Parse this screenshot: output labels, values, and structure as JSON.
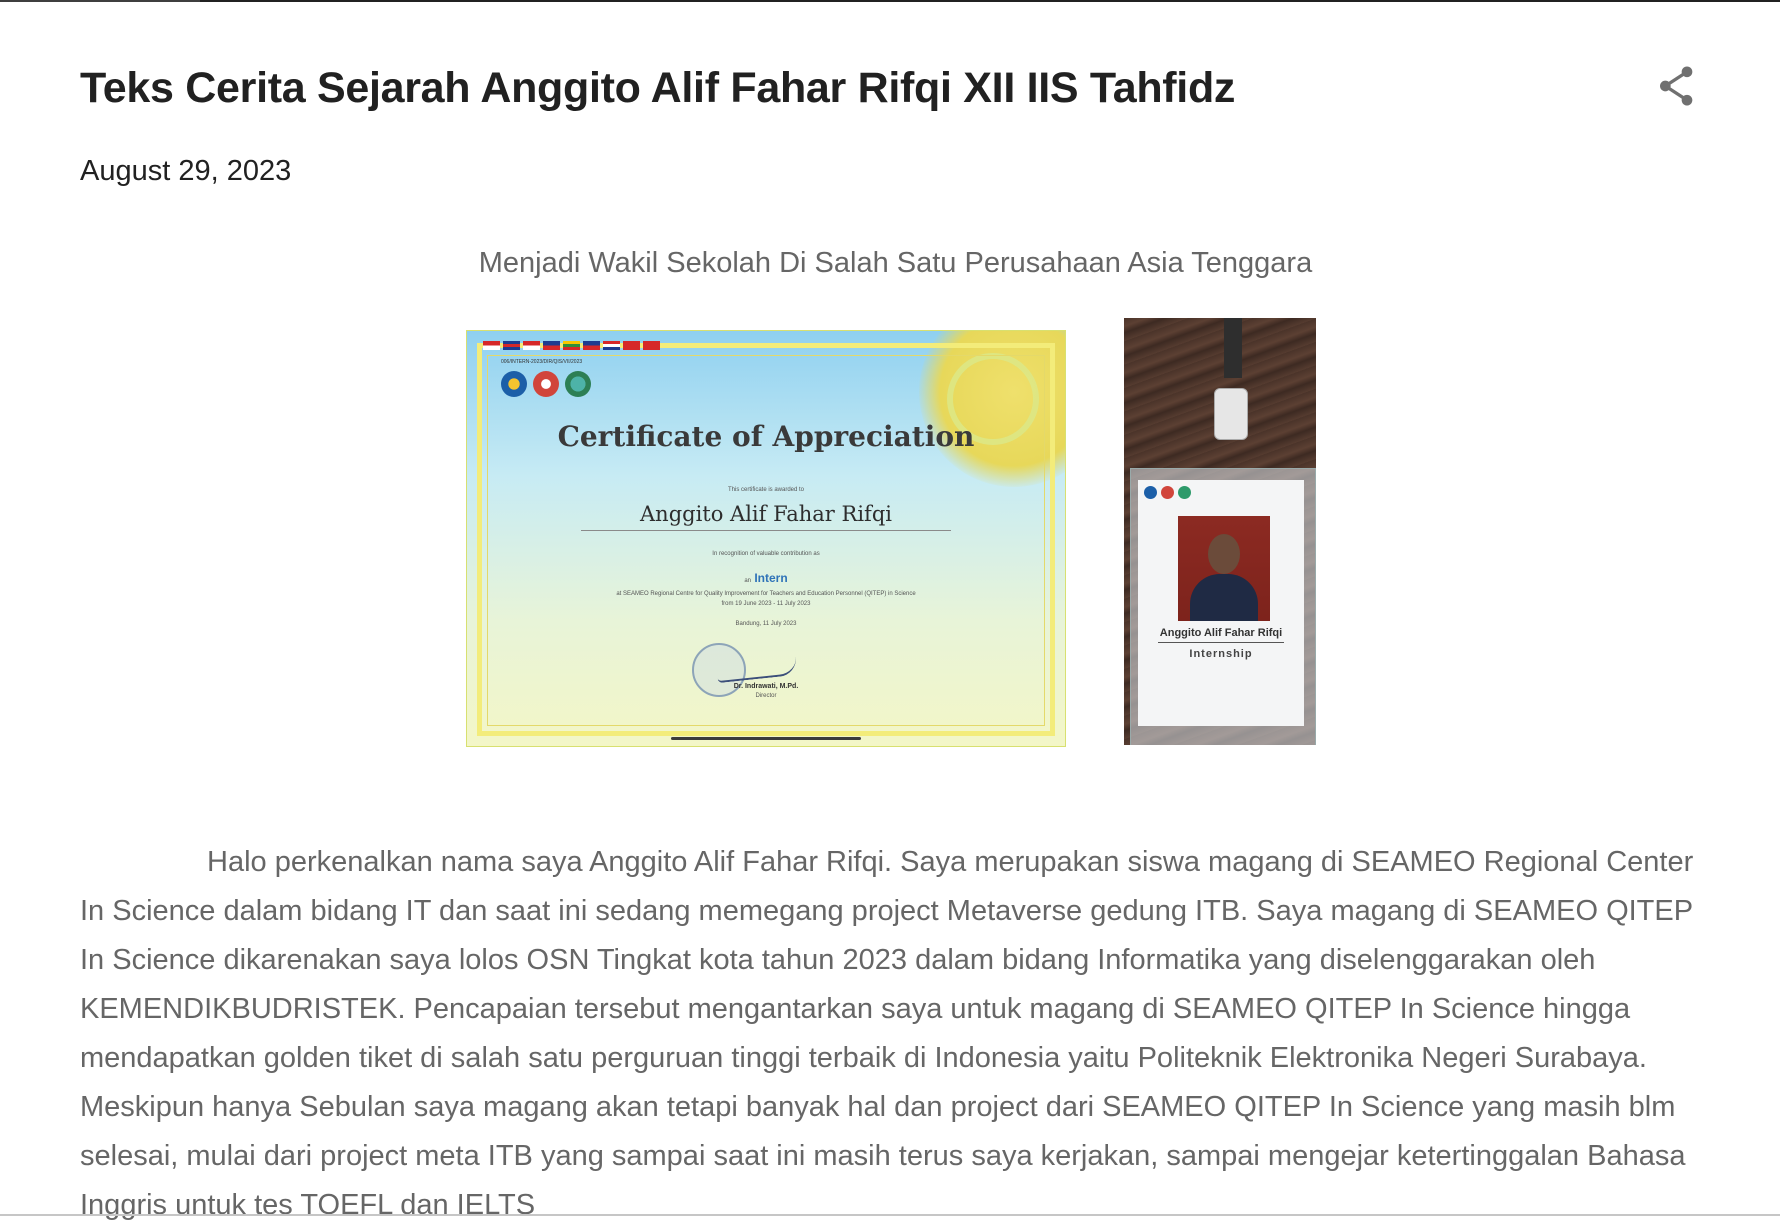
{
  "post": {
    "title": "Teks Cerita Sejarah Anggito Alif Fahar Rifqi XII IIS Tahfidz",
    "date": "August 29, 2023",
    "subheading": "Menjadi Wakil Sekolah Di Salah Satu Perusahaan Asia Tenggara",
    "body": "Halo perkenalkan nama saya Anggito Alif Fahar Rifqi. Saya merupakan siswa magang di SEAMEO Regional Center In Science dalam bidang IT dan saat ini sedang memegang project Metaverse gedung ITB. Saya magang di SEAMEO QITEP In Science dikarenakan saya lolos OSN Tingkat kota tahun 2023 dalam bidang Informatika yang diselenggarakan oleh KEMENDIKBUDRISTEK. Pencapaian tersebut mengantarkan saya untuk magang di SEAMEO QITEP In Science hingga mendapatkan golden tiket di salah satu perguruan tinggi terbaik di Indonesia yaitu Politeknik Elektronika Negeri Surabaya. Meskipun hanya Sebulan saya magang akan tetapi banyak hal dan project dari SEAMEO QITEP In Science yang masih blm selesai, mulai dari project meta ITB yang sampai saat ini masih terus saya kerjakan, sampai mengejar ketertinggalan Bahasa Inggris untuk tes TOEFL dan IELTS"
  },
  "share_icon": "share-icon",
  "certificate": {
    "title": "Certificate of Appreciation",
    "ref": "006/INTERN-2023/DIR/QIS/VII/2023",
    "awarded_line": "This certificate is awarded to",
    "recipient": "Anggito Alif Fahar Rifqi",
    "recognition_line": "In recognition of valuable contribution as",
    "role_prefix": "an",
    "role": "Intern",
    "institution_line": "at SEAMEO Regional Centre for Quality Improvement for Teachers and Education Personnel (QITEP) in Science",
    "period_line": "from 19 June 2023 - 11 July 2023",
    "place_date": "Bandung, 11 July 2023",
    "signer": "Dr. Indrawati, M.Pd.",
    "signer_role": "Director"
  },
  "id_badge": {
    "name": "Anggito Alif Fahar Rifqi",
    "role": "Internship"
  },
  "colors": {
    "title": "#212121",
    "muted_text": "#666666",
    "role_text": "#2f73b8"
  }
}
